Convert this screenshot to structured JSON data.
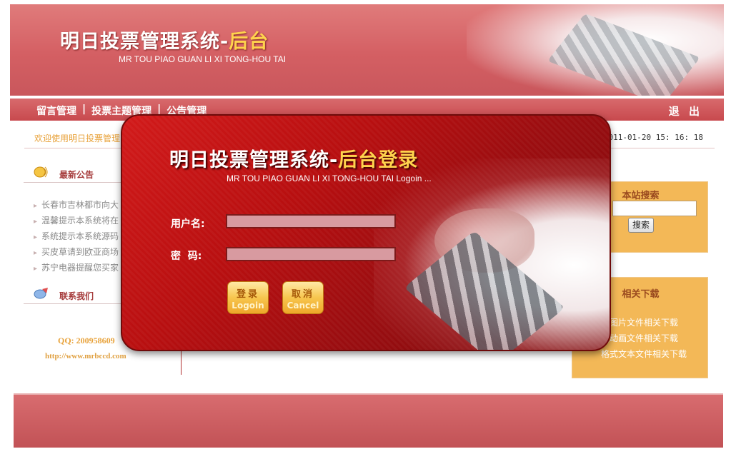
{
  "header": {
    "title_main": "明日投票管理系统-",
    "title_highlight": "后台",
    "subtitle": "MR TOU PIAO GUAN LI XI TONG-HOU TAI"
  },
  "nav": {
    "items": [
      "留言管理",
      "投票主题管理",
      "公告管理"
    ],
    "separator": "|",
    "logout": "退 出"
  },
  "welcome": {
    "message": "欢迎使用明日投票管理",
    "datetime": "2011-01-20 15: 16: 18"
  },
  "sidebar": {
    "news_title": "最新公告",
    "news_items": [
      "长春市吉林都市向大",
      "温馨提示本系统将在",
      "系统提示本系统源码",
      "买皮草请到欧亚商场",
      "苏宁电器提醒您买家"
    ],
    "contact_title": "联系我们",
    "qq": "QQ: 200958609",
    "url": "http://www.mrbccd.com"
  },
  "right": {
    "search_title": "本站搜索",
    "search_button": "搜索",
    "downloads_title": "相关下载",
    "downloads_items": [
      "式图片文件相关下载",
      "式动画文件相关下载",
      "格式文本文件相关下载"
    ]
  },
  "login": {
    "title_main": "明日投票管理系统-",
    "title_highlight": "后台登录",
    "subtitle": "MR TOU PIAO GUAN LI XI TONG-HOU TAI Logoin ...",
    "username_label": "用户名:",
    "password_label": "密  码:",
    "username_value": "",
    "password_value": "",
    "login_button": "登录",
    "login_button_en": "Logoin",
    "cancel_button": "取消",
    "cancel_button_en": "Cancel"
  },
  "colors": {
    "banner": "#d45f63",
    "dialog": "#b80f10",
    "accent_yellow": "#ffd34d",
    "side_box": "#f3b857"
  }
}
